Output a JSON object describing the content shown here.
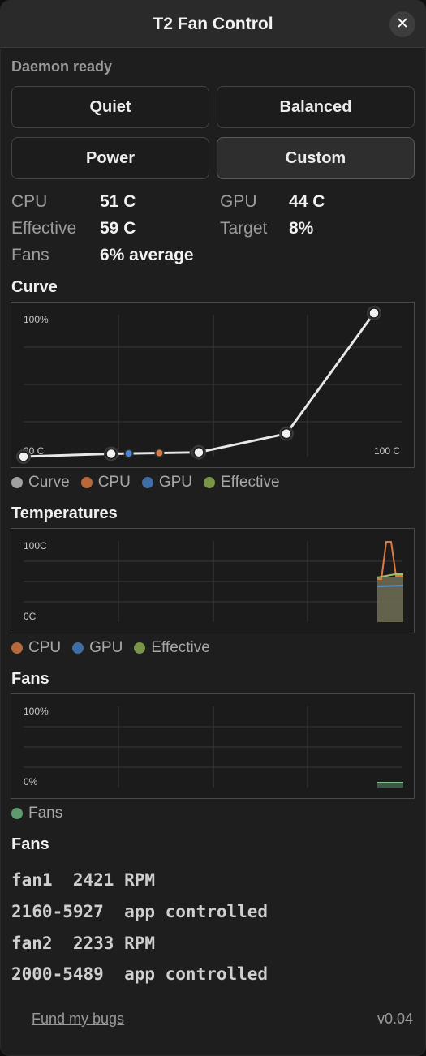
{
  "window": {
    "title": "T2 Fan Control",
    "close_label": "✕"
  },
  "status": "Daemon ready",
  "modes": [
    "Quiet",
    "Balanced",
    "Power",
    "Custom"
  ],
  "active_mode": "Custom",
  "stats": {
    "cpu_label": "CPU",
    "cpu_value": "51 C",
    "gpu_label": "GPU",
    "gpu_value": "44 C",
    "effective_label": "Effective",
    "effective_value": "59 C",
    "target_label": "Target",
    "target_value": "8%",
    "fans_label": "Fans",
    "fans_value": "6% average"
  },
  "colors": {
    "curve": "#e8e8e8",
    "cpu": "#e07a3c",
    "gpu": "#4a86d8",
    "effective": "#86b04a",
    "fans": "#5d9a6e"
  },
  "curve": {
    "title": "Curve",
    "label_top": "100%",
    "label_left": "20 C",
    "label_right": "100 C",
    "legend": [
      "Curve",
      "CPU",
      "GPU",
      "Effective"
    ],
    "chart_data": {
      "type": "line",
      "series": [
        {
          "name": "Curve",
          "x": [
            20,
            40,
            60,
            80,
            100
          ],
          "y": [
            0,
            2,
            3,
            16,
            100
          ]
        }
      ],
      "markers": [
        {
          "name": "GPU",
          "x": 44
        },
        {
          "name": "CPU",
          "x": 51
        },
        {
          "name": "Effective",
          "x": 59
        }
      ],
      "xlim": [
        20,
        100
      ],
      "ylim": [
        0,
        100
      ]
    }
  },
  "temperatures": {
    "title": "Temperatures",
    "label_top": "100C",
    "label_bottom": "0C",
    "legend": [
      "CPU",
      "GPU",
      "Effective"
    ]
  },
  "fans_chart": {
    "title": "Fans",
    "label_top": "100%",
    "label_bottom": "0%",
    "legend": [
      "Fans"
    ]
  },
  "fans_list": {
    "title": "Fans",
    "lines": [
      "fan1  2421 RPM",
      "2160-5927  app controlled",
      "fan2  2233 RPM",
      "2000-5489  app controlled"
    ]
  },
  "footer": {
    "link": "Fund my bugs",
    "version": "v0.04"
  }
}
